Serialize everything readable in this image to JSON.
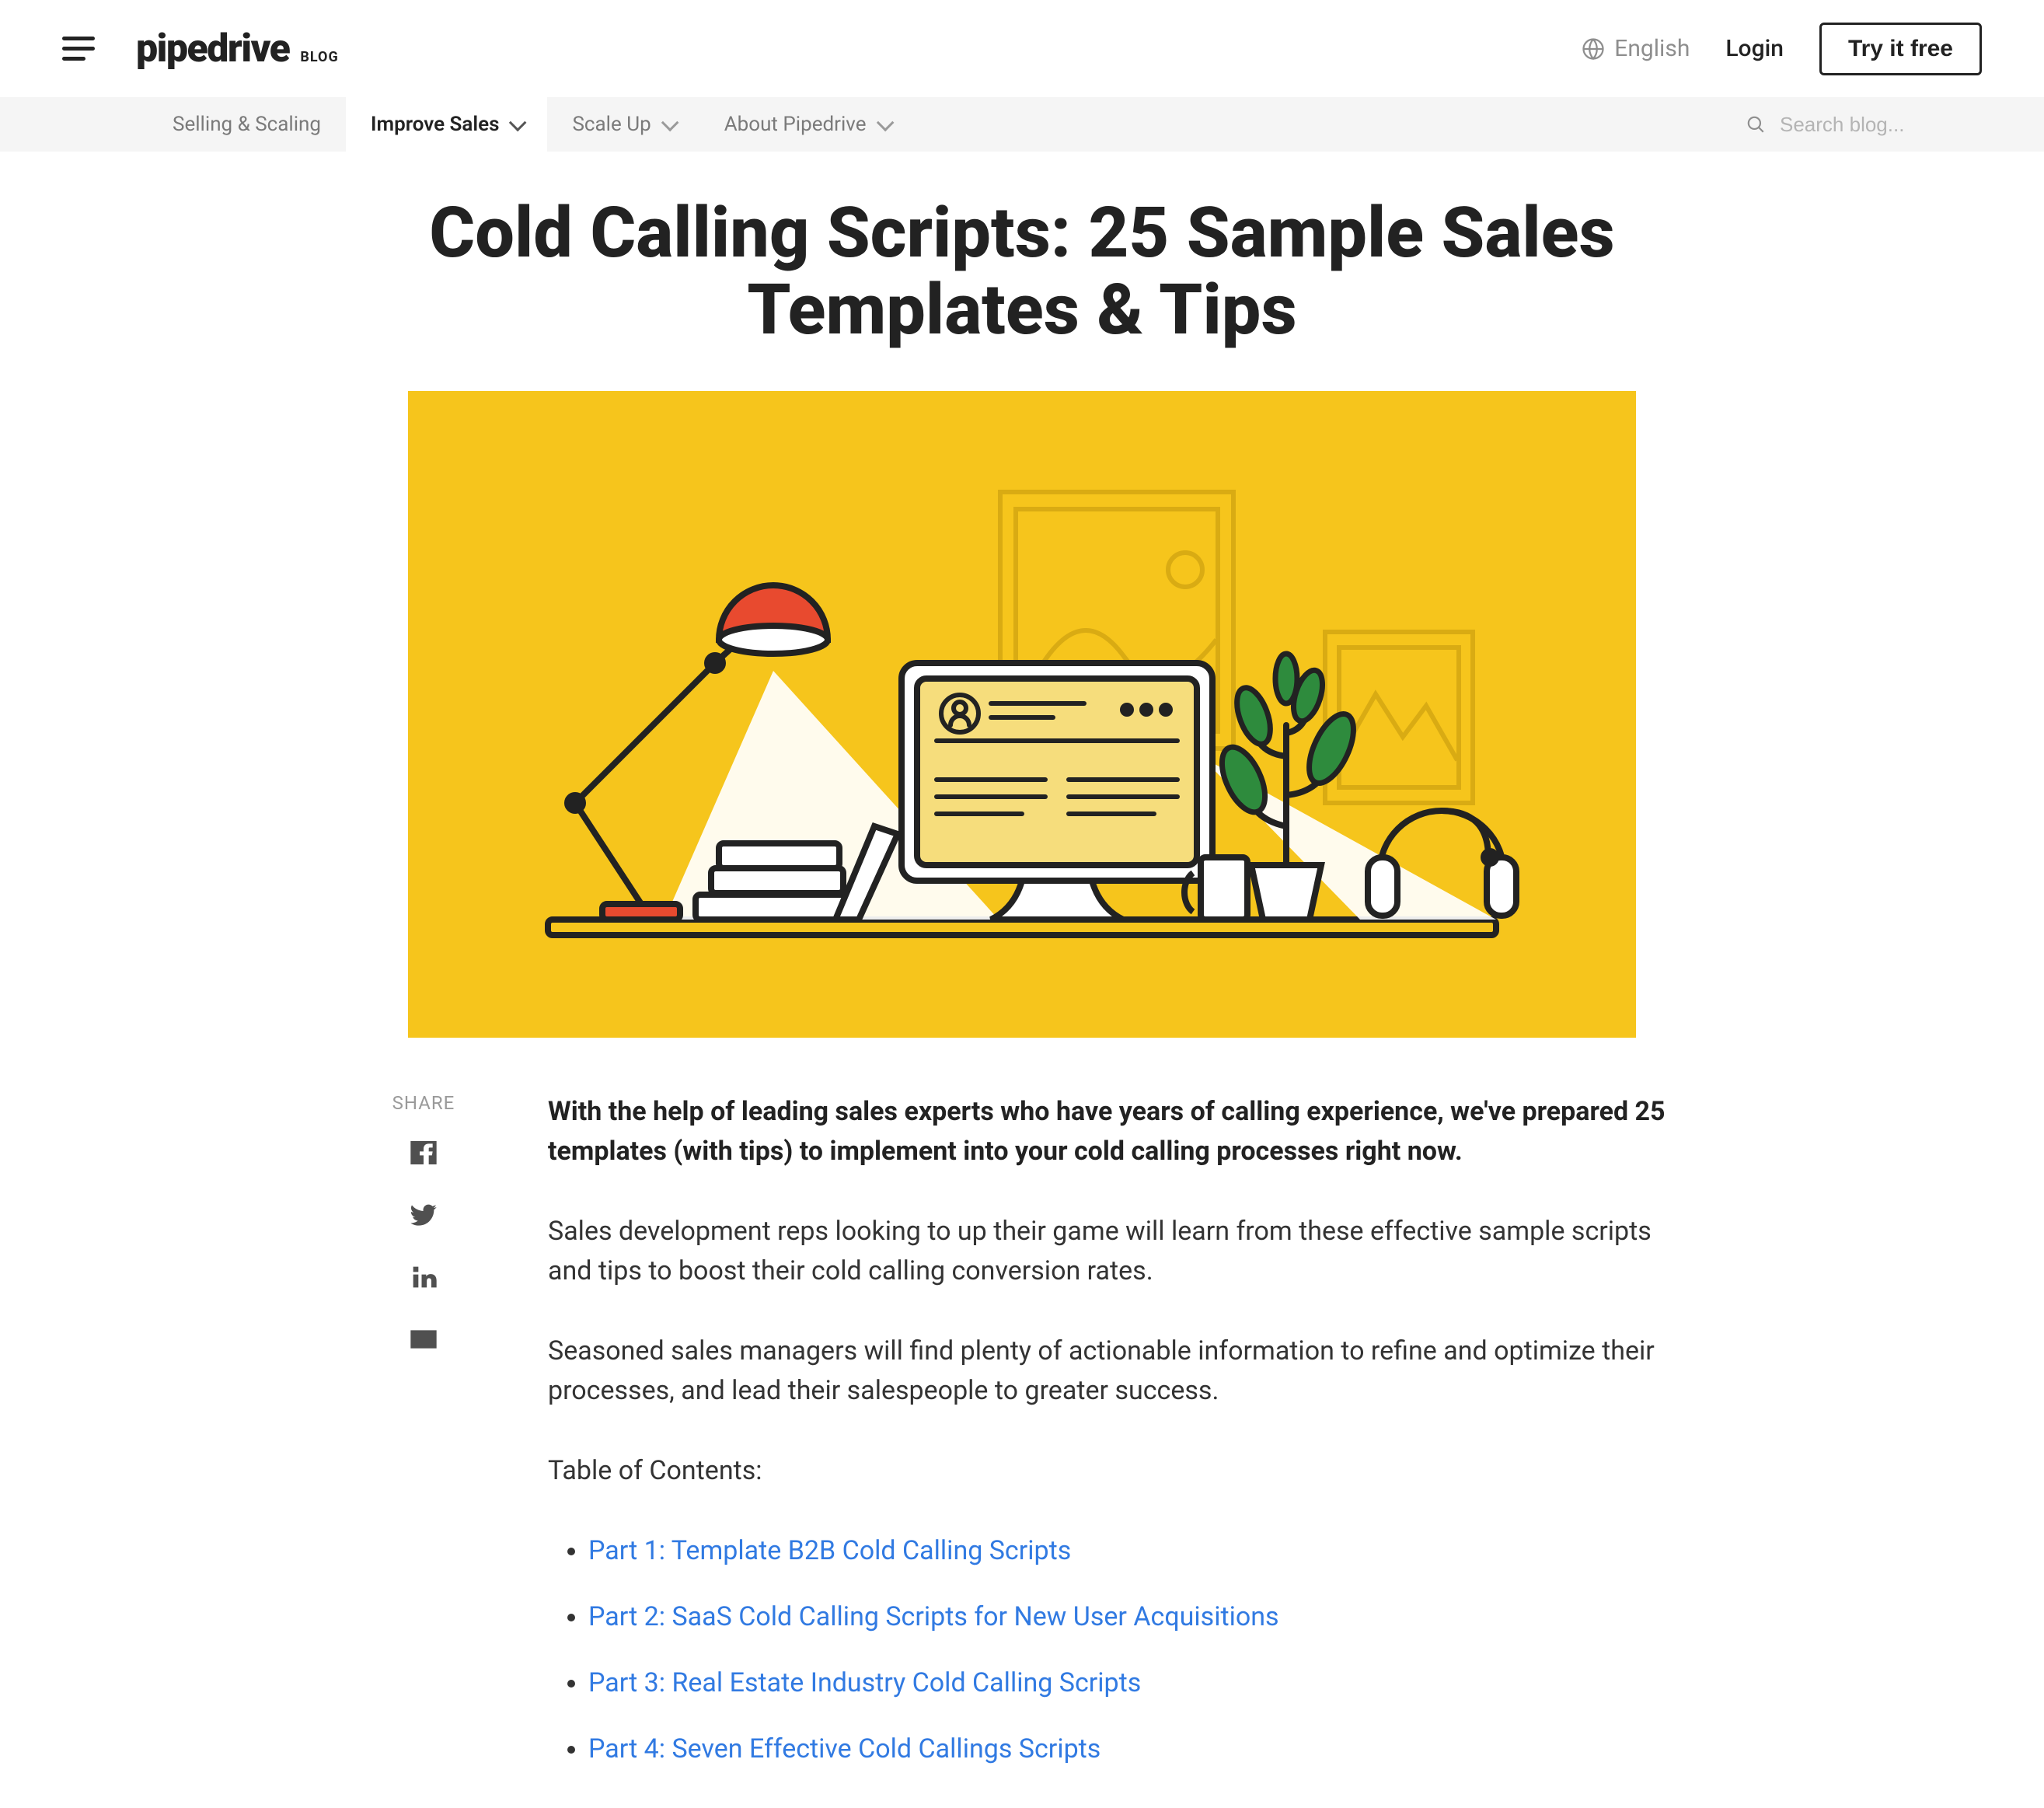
{
  "header": {
    "logo_text": "pipedrive",
    "logo_suffix": "BLOG",
    "language_label": "English",
    "login_label": "Login",
    "try_button_label": "Try it free"
  },
  "nav": {
    "items": [
      {
        "label": "Selling & Scaling",
        "has_chevron": false,
        "active": false
      },
      {
        "label": "Improve Sales",
        "has_chevron": true,
        "active": true
      },
      {
        "label": "Scale Up",
        "has_chevron": true,
        "active": false
      },
      {
        "label": "About Pipedrive",
        "has_chevron": true,
        "active": false
      }
    ],
    "search_placeholder": "Search blog..."
  },
  "article": {
    "title": "Cold Calling Scripts: 25 Sample Sales Templates & Tips",
    "hero_alt": "Illustration of a desk with lamp, monitor, plant and headphones on a yellow background",
    "share_label": "SHARE",
    "intro": "With the help of leading sales experts who have years of calling experience, we've prepared 25 templates (with tips) to implement into your cold calling processes right now.",
    "paragraphs": [
      "Sales development reps looking to up their game will learn from these effective sample scripts and tips to boost their cold calling conversion rates.",
      "Seasoned sales managers will find plenty of actionable information to refine and optimize their processes, and lead their salespeople to greater success."
    ],
    "toc_heading": "Table of Contents:",
    "toc": [
      "Part 1: Template B2B Cold Calling Scripts",
      "Part 2: SaaS Cold Calling Scripts for New User Acquisitions",
      "Part 3: Real Estate Industry Cold Calling Scripts",
      "Part 4: Seven Effective Cold Callings Scripts"
    ]
  },
  "colors": {
    "hero_bg": "#f6c51c",
    "link": "#317ae2"
  }
}
